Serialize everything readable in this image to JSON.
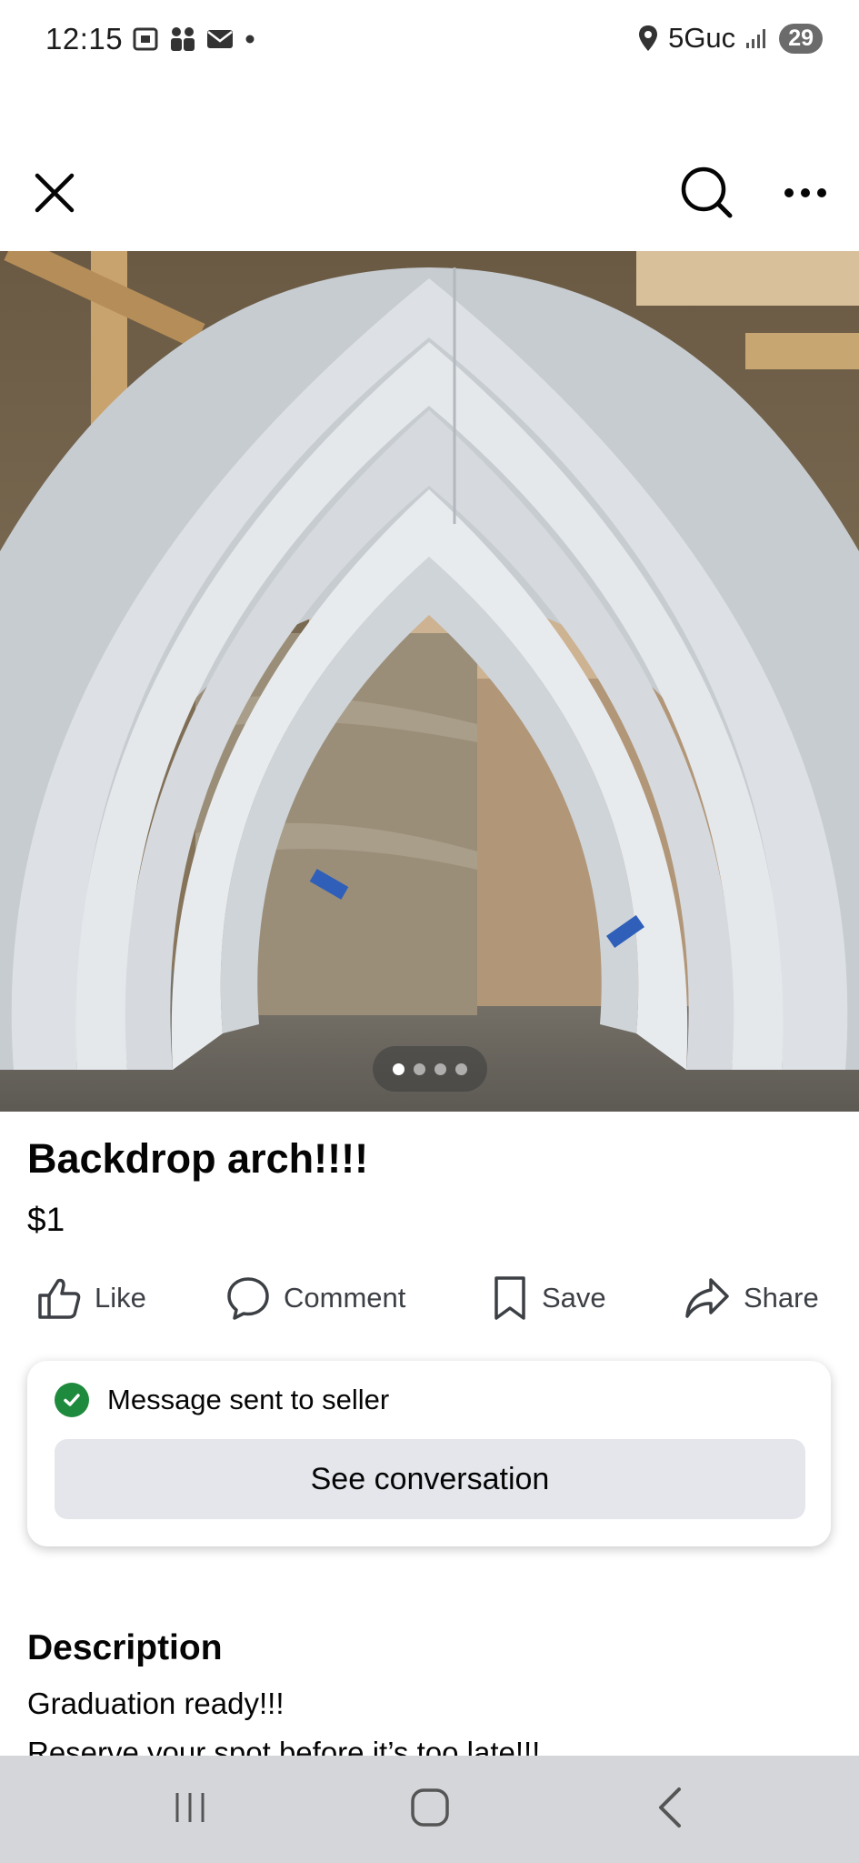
{
  "status_bar": {
    "time": "12:15",
    "network": "5Guc",
    "battery": "29"
  },
  "listing": {
    "title": "Backdrop arch!!!!",
    "price": "$1",
    "photo_count": 4,
    "active_photo": 1
  },
  "actions": {
    "like": "Like",
    "comment": "Comment",
    "save": "Save",
    "share": "Share"
  },
  "message_card": {
    "status": "Message sent to seller",
    "button": "See conversation"
  },
  "description": {
    "heading": "Description",
    "line1": "Graduation ready!!!",
    "line2": "Reserve your spot before it’s too late!!!"
  },
  "icons": {
    "close": "close-icon",
    "search": "search-icon",
    "more": "more-icon",
    "like": "thumbs-up-icon",
    "comment": "comment-icon",
    "save": "bookmark-icon",
    "share": "share-icon",
    "check": "check-circle-icon",
    "recents": "recents-icon",
    "home": "home-icon",
    "back": "back-icon"
  },
  "colors": {
    "check_green": "#1e8a3e",
    "button_gray": "#e4e6eb",
    "nav_bar": "#d4d6da"
  }
}
